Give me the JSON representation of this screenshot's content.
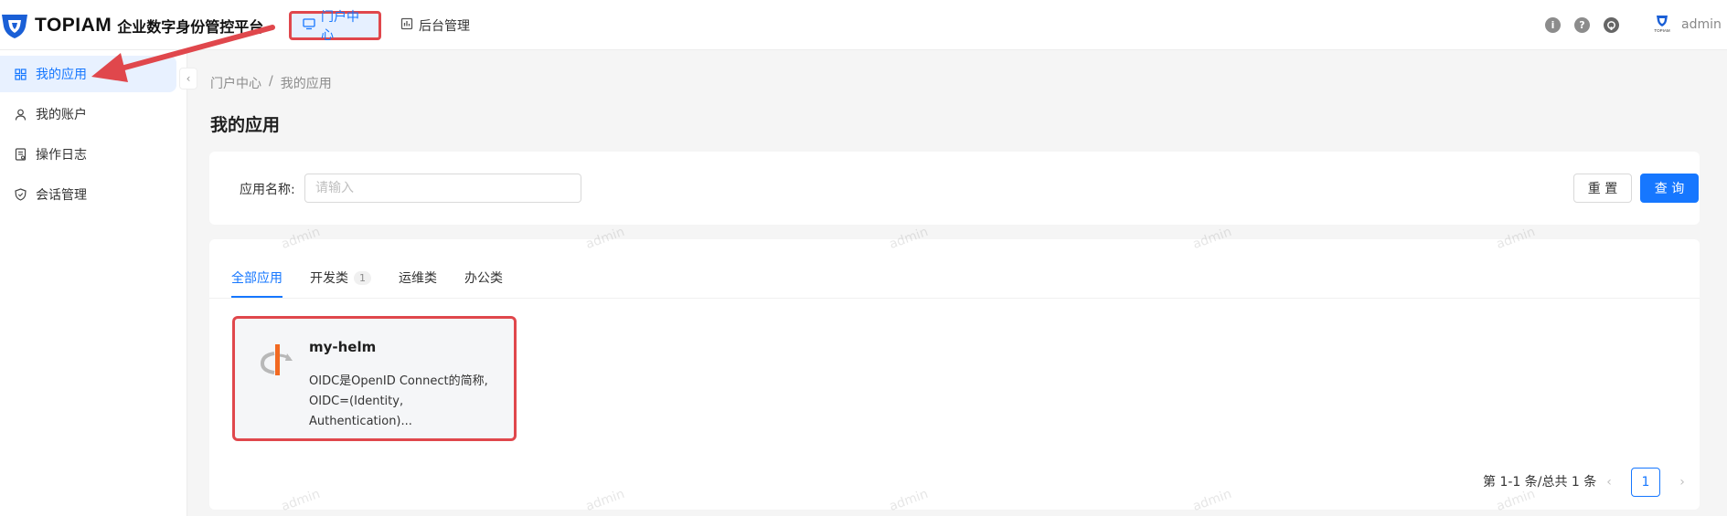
{
  "header": {
    "logo_word": "TOPIAM",
    "logo_subtitle": "企业数字身份管控平台",
    "nav": [
      {
        "label": "门户中心",
        "icon": "monitor-icon",
        "active": true
      },
      {
        "label": "后台管理",
        "icon": "dashboard-icon",
        "active": false
      }
    ],
    "icons": [
      "info-icon",
      "help-icon",
      "github-icon"
    ],
    "user": {
      "name": "admin",
      "avatar_text": "TOPIAM"
    }
  },
  "sidebar": {
    "items": [
      {
        "label": "我的应用",
        "icon": "apps-grid-icon",
        "active": true
      },
      {
        "label": "我的账户",
        "icon": "user-icon",
        "active": false
      },
      {
        "label": "操作日志",
        "icon": "log-icon",
        "active": false
      },
      {
        "label": "会话管理",
        "icon": "shield-icon",
        "active": false
      }
    ]
  },
  "breadcrumb": [
    "门户中心",
    "/",
    "我的应用"
  ],
  "page_title": "我的应用",
  "search": {
    "label": "应用名称:",
    "placeholder": "请输入",
    "value": "",
    "reset_label": "重 置",
    "query_label": "查 询"
  },
  "tabs": [
    {
      "label": "全部应用",
      "count": null,
      "active": true
    },
    {
      "label": "开发类",
      "count": "1",
      "active": false
    },
    {
      "label": "运维类",
      "count": null,
      "active": false
    },
    {
      "label": "办公类",
      "count": null,
      "active": false
    }
  ],
  "apps": [
    {
      "name": "my-helm",
      "description": "OIDC是OpenID Connect的简称,OIDC=(Identity, Authentication)...",
      "desc_line1": "OIDC是OpenID Connect的简称,",
      "desc_line2": "OIDC=(Identity, Authentication)..."
    }
  ],
  "pagination": {
    "total_text": "第 1-1 条/总共 1 条",
    "current_page": "1"
  },
  "watermark": "admin",
  "colors": {
    "primary": "#1677ff",
    "highlight_border": "#e0474c",
    "annotation_arrow": "#e0474c"
  }
}
